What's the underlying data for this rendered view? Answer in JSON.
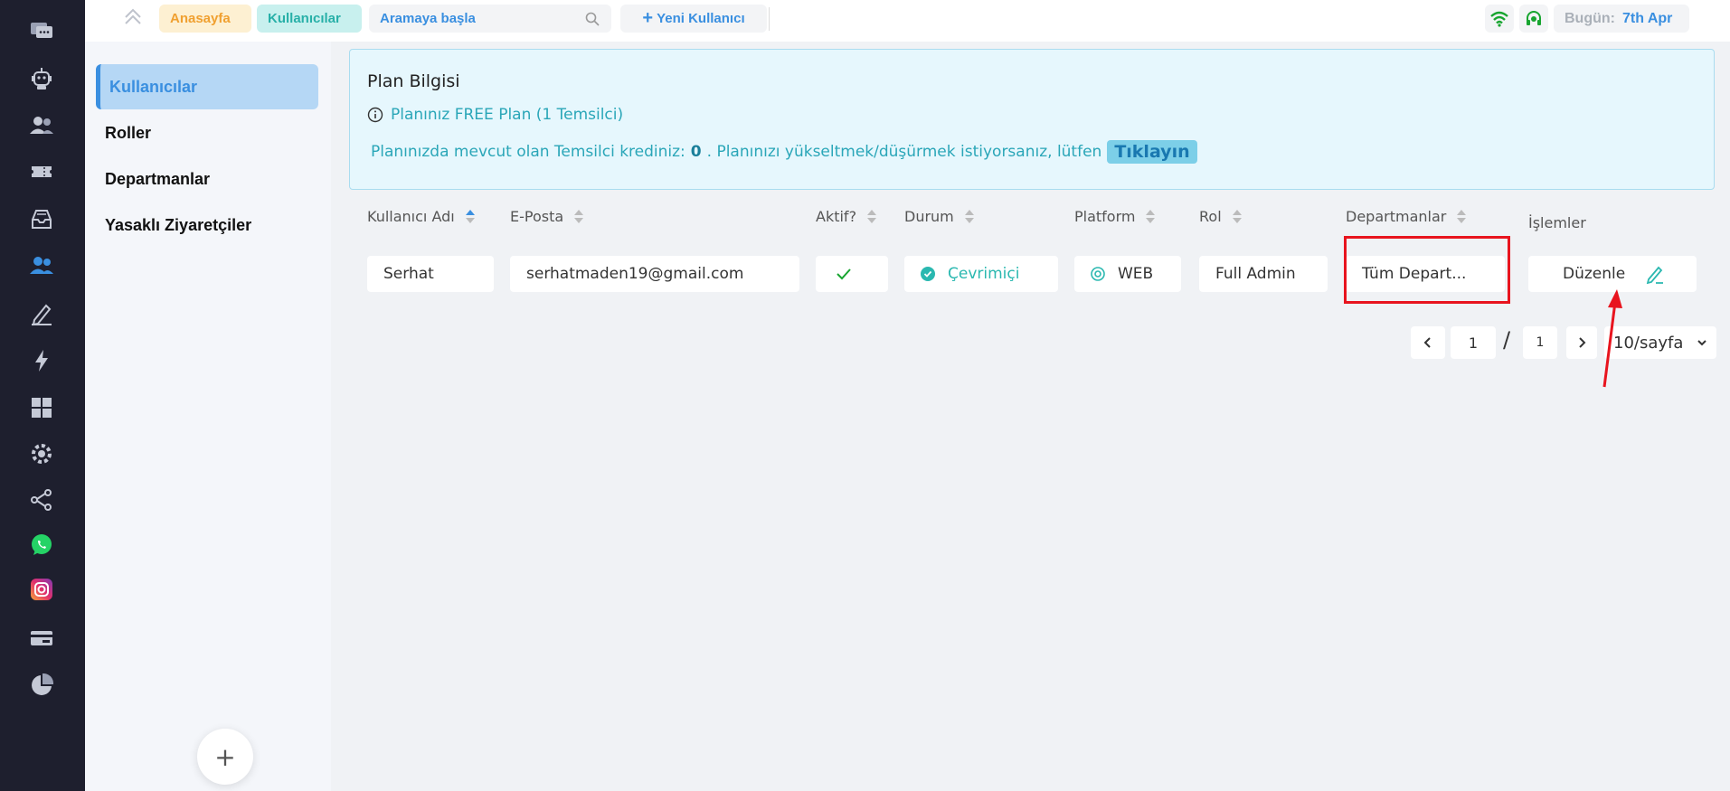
{
  "topbar": {
    "breadcrumb_home": "Anasayfa",
    "breadcrumb_users": "Kullanıcılar",
    "search_placeholder": "Aramaya başla",
    "new_user_label": "Yeni Kullanıcı",
    "today_label": "Bugün:",
    "today_value": "7th Apr"
  },
  "subnav": {
    "items": [
      "Kullanıcılar",
      "Roller",
      "Departmanlar",
      "Yasaklı Ziyaretçiler"
    ],
    "add_label": "+"
  },
  "plan": {
    "title": "Plan Bilgisi",
    "subtitle": "Planınız FREE Plan (1 Temsilci)",
    "credit_prefix": "Planınızda mevcut olan Temsilci krediniz:",
    "credit_value": "0",
    "credit_suffix": ". Planınızı yükseltmek/düşürmek istiyorsanız, lütfen",
    "click_label": "Tıklayın"
  },
  "table": {
    "columns": [
      "Kullanıcı Adı",
      "E-Posta",
      "Aktif?",
      "Durum",
      "Platform",
      "Rol",
      "Departmanlar",
      "İşlemler"
    ],
    "rows": [
      {
        "username": "Serhat",
        "email": "serhatmaden19@gmail.com",
        "status": "Çevrimiçi",
        "platform": "WEB",
        "role": "Full Admin",
        "departments": "Tüm Depart...",
        "action": "Düzenle"
      }
    ]
  },
  "pagination": {
    "current_page": "1",
    "separator": "/",
    "total_pages": "1",
    "per_page": "10/sayfa"
  },
  "colors": {
    "accent": "#3a8fe0",
    "rail": "#1e1f2e",
    "teal": "#2aa6b8",
    "highlight": "#e8141e"
  }
}
